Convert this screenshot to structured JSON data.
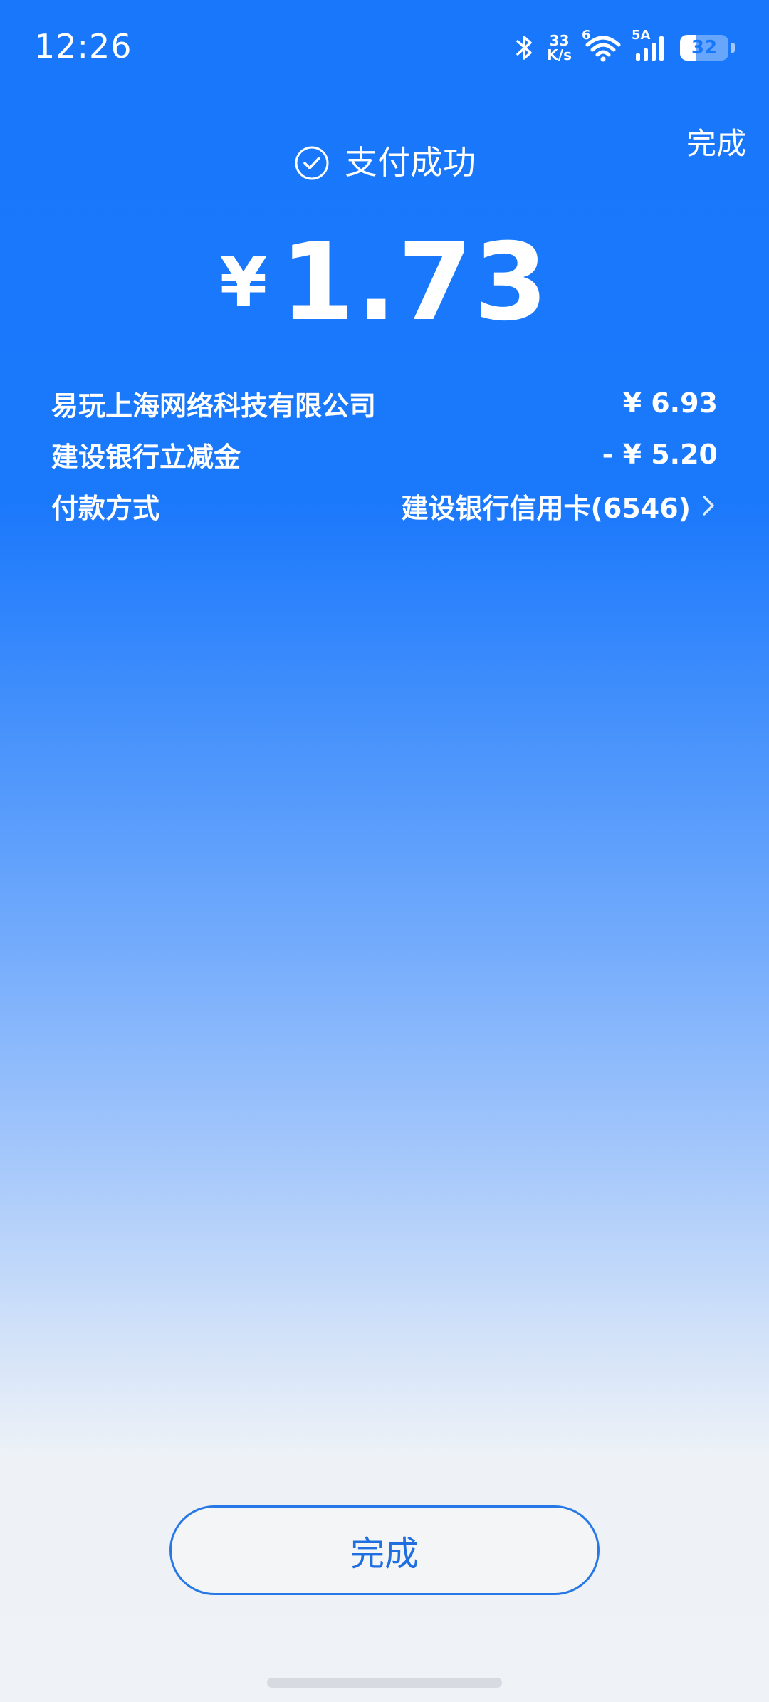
{
  "status_bar": {
    "time": "12:26",
    "net_speed_value": "33",
    "net_speed_unit": "K/s",
    "wifi_tag": "6",
    "signal_tag": "5A",
    "battery": "32",
    "battery_level": 0.32
  },
  "header": {
    "done_label": "完成",
    "result_text": "支付成功"
  },
  "amount": {
    "currency": "¥",
    "value": "1.73"
  },
  "details": [
    {
      "label": "易玩上海网络科技有限公司",
      "value": "¥ 6.93"
    },
    {
      "label": "建设银行立减金",
      "value": "- ¥ 5.20"
    },
    {
      "label": "付款方式",
      "value": "建设银行信用卡(6546)"
    }
  ],
  "footer": {
    "done_button_label": "完成"
  },
  "colors": {
    "primary_blue": "#1877fb",
    "button_border": "#2778e6",
    "button_text": "#1f6fe0",
    "background_bottom": "#eff2f7"
  }
}
